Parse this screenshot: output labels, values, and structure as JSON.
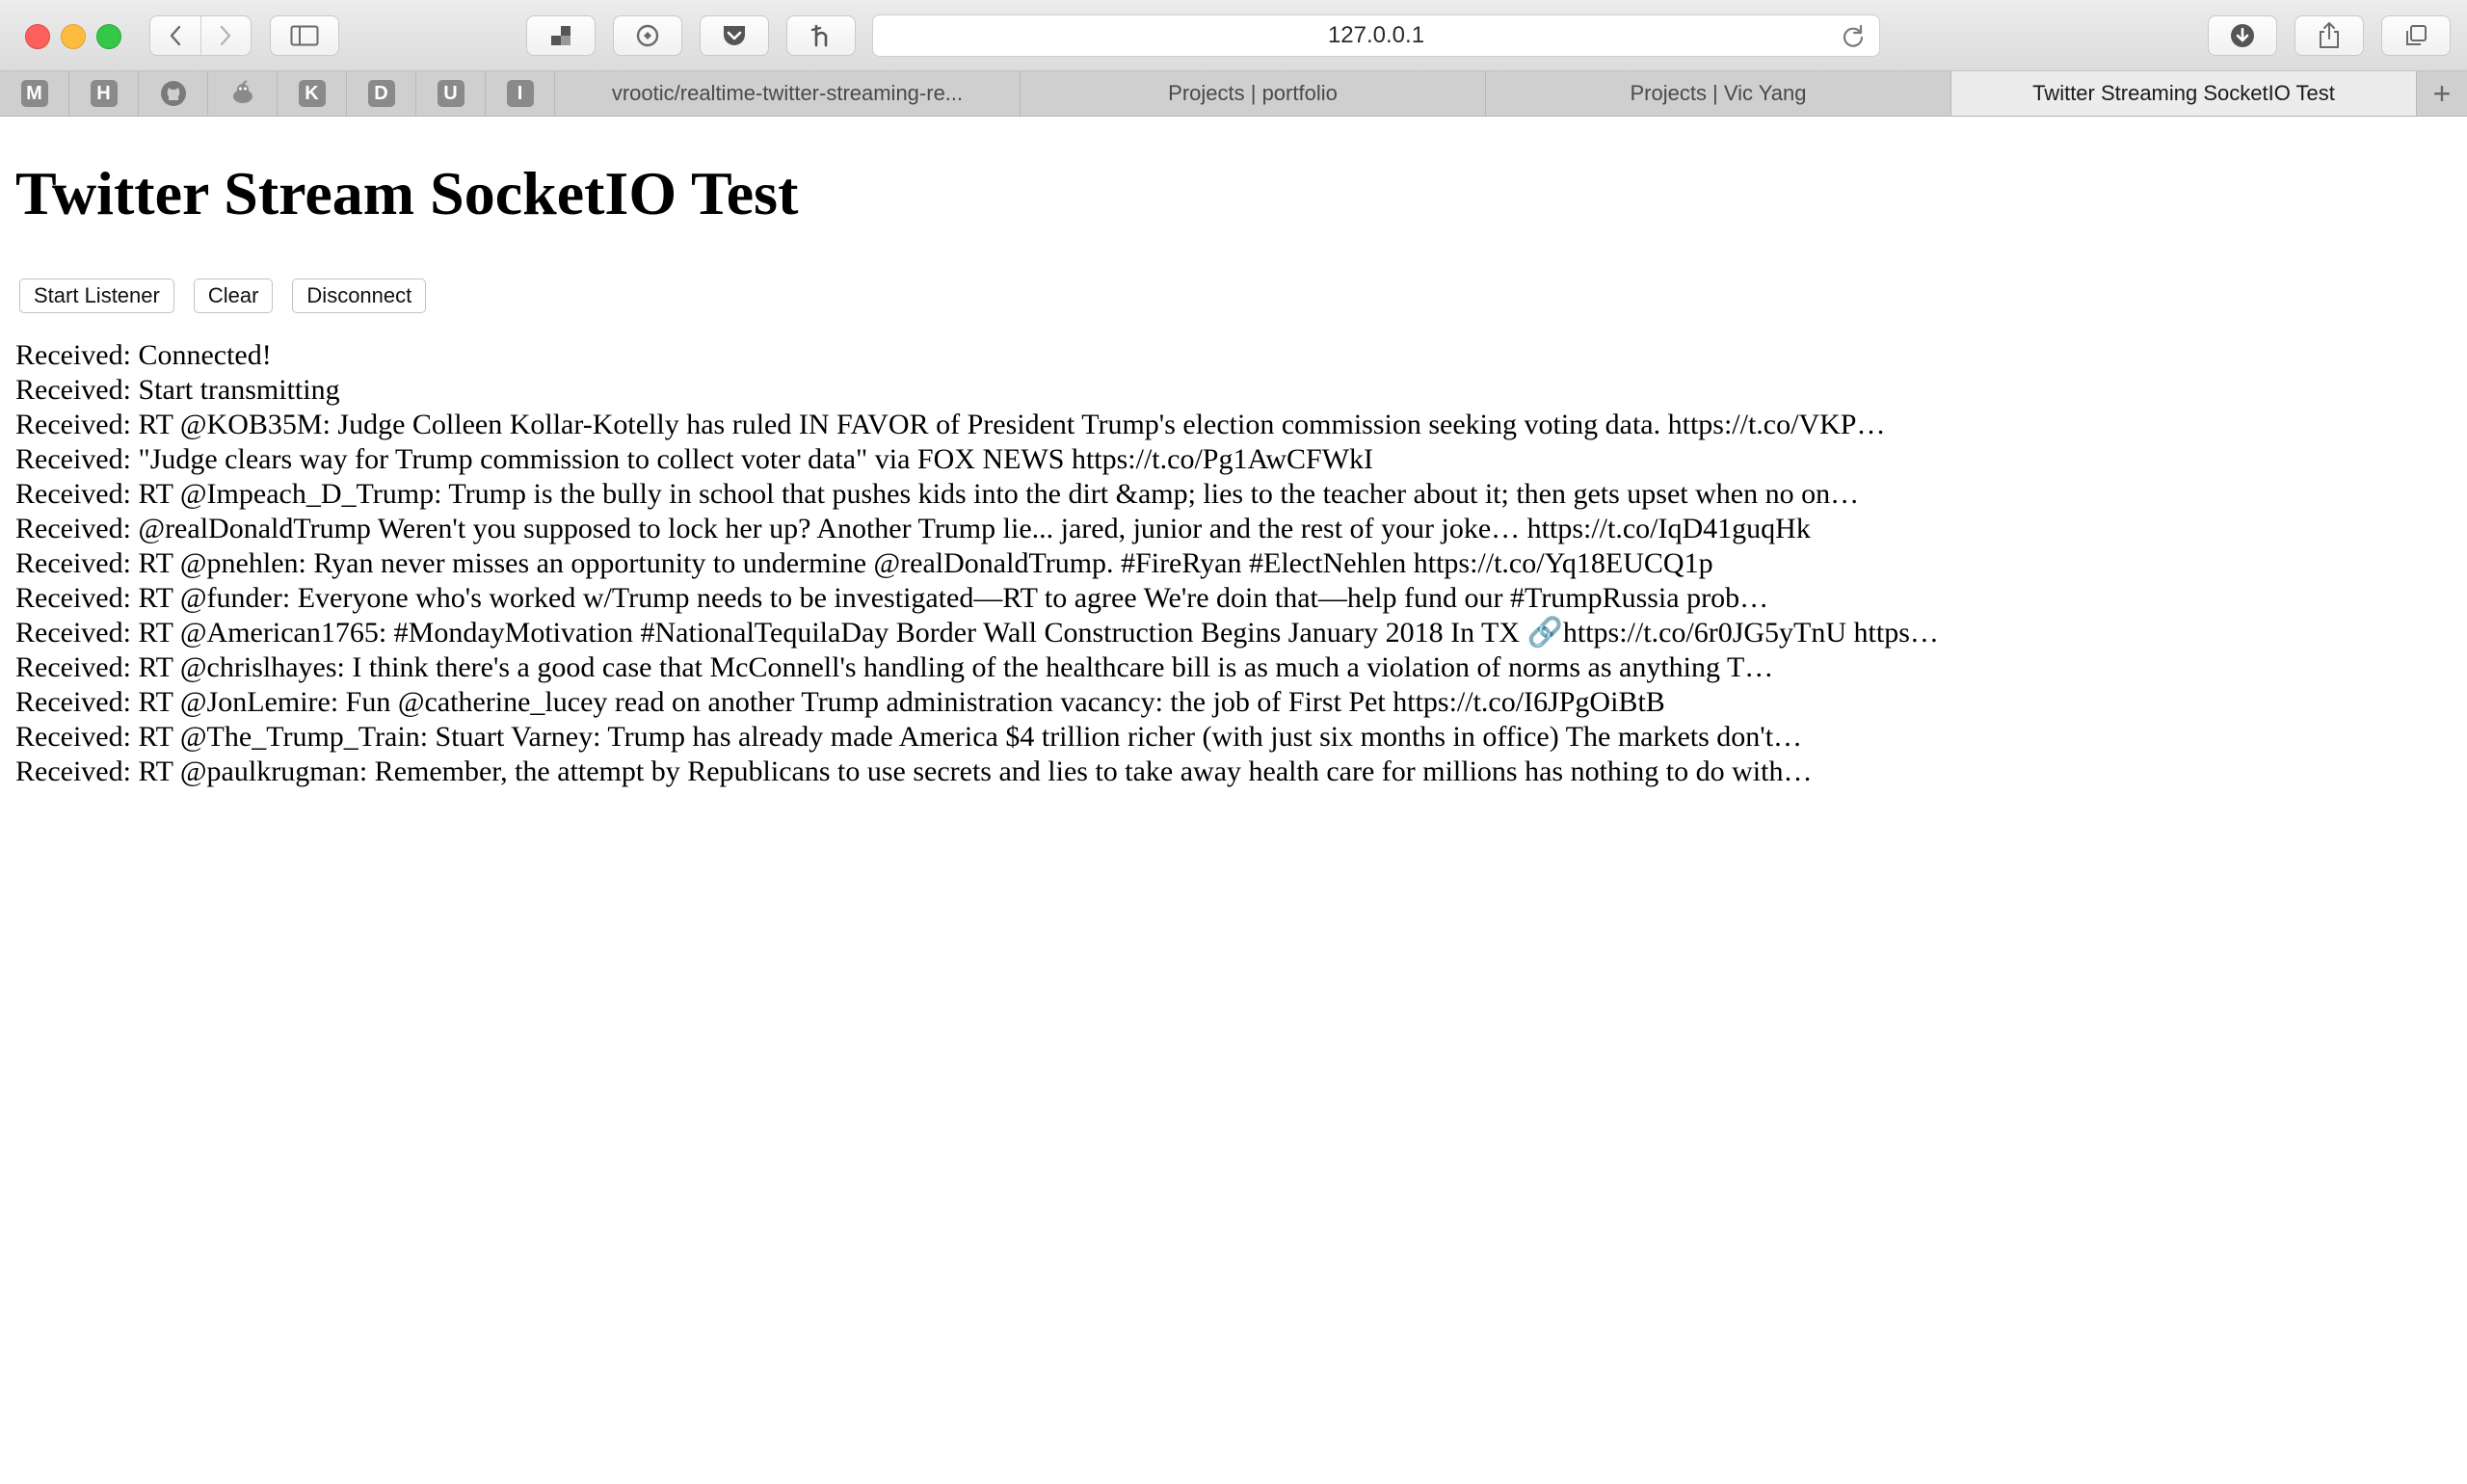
{
  "browser": {
    "url": "127.0.0.1",
    "favorites": [
      "M",
      "H",
      "github",
      "reddit",
      "K",
      "D",
      "U",
      "I"
    ],
    "tabs": [
      {
        "label": "vrootic/realtime-twitter-streaming-re..."
      },
      {
        "label": "Projects | portfolio"
      },
      {
        "label": "Projects | Vic Yang"
      },
      {
        "label": "Twitter Streaming SocketIO Test"
      }
    ],
    "new_tab_label": "+"
  },
  "page": {
    "title": "Twitter Stream SocketIO Test",
    "buttons": {
      "start": "Start Listener",
      "clear": "Clear",
      "disconnect": "Disconnect"
    },
    "messages": [
      "Received: Connected!",
      "Received: Start transmitting",
      "Received: RT @KOB35M: Judge Colleen Kollar-Kotelly has ruled IN FAVOR of President Trump's election commission seeking voting data. https://t.co/VKP…",
      "Received: \"Judge clears way for Trump commission to collect voter data\" via FOX NEWS https://t.co/Pg1AwCFWkI",
      "Received: RT @Impeach_D_Trump: Trump is the bully in school that pushes kids into the dirt &amp; lies to the teacher about it; then gets upset when no on…",
      "Received: @realDonaldTrump Weren't you supposed to lock her up? Another Trump lie... jared, junior and the rest of your joke… https://t.co/IqD41guqHk",
      "Received: RT @pnehlen: Ryan never misses an opportunity to undermine @realDonaldTrump. #FireRyan #ElectNehlen https://t.co/Yq18EUCQ1p",
      "Received: RT @funder: Everyone who's worked w/Trump needs to be investigated—RT to agree We're doin that—help fund our #TrumpRussia prob…",
      "Received: RT @American1765: #MondayMotivation #NationalTequilaDay Border Wall Construction Begins January 2018 In TX 🔗https://t.co/6r0JG5yTnU https…",
      "Received: RT @chrislhayes: I think there's a good case that McConnell's handling of the healthcare bill is as much a violation of norms as anything T…",
      "Received: RT @JonLemire: Fun @catherine_lucey read on another Trump administration vacancy: the job of First Pet https://t.co/I6JPgOiBtB",
      "Received: RT @The_Trump_Train: Stuart Varney: Trump has already made America $4 trillion richer (with just six months in office) The markets don't…",
      "Received: RT @paulkrugman: Remember, the attempt by Republicans to use secrets and lies to take away health care for millions has nothing to do with…"
    ]
  }
}
